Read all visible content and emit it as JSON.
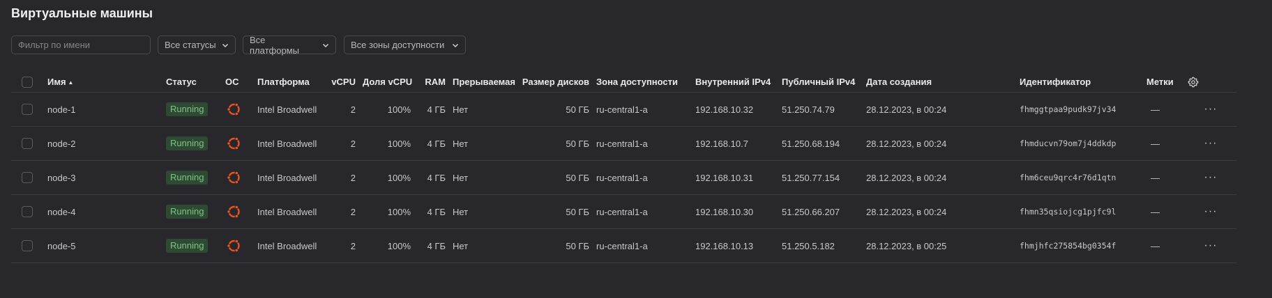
{
  "page": {
    "title": "Виртуальные машины"
  },
  "filters": {
    "name_placeholder": "Фильтр по имени",
    "status_select": "Все статусы",
    "platform_select": "Все платформы",
    "zone_select": "Все зоны доступности"
  },
  "table": {
    "columns": {
      "name": "Имя",
      "status": "Статус",
      "os": "ОС",
      "platform": "Платформа",
      "vcpu": "vCPU",
      "vcpu_share": "Доля vCPU",
      "ram": "RAM",
      "preemptible": "Прерываемая",
      "disk_size": "Размер дисков",
      "zone": "Зона доступности",
      "internal_ip": "Внутренний IPv4",
      "public_ip": "Публичный IPv4",
      "created": "Дата создания",
      "id": "Идентификатор",
      "labels": "Метки"
    },
    "sort_indicator": "▲",
    "os_icon": "ubuntu-icon",
    "status_color": "#7fc284",
    "rows": [
      {
        "name": "node-1",
        "status": "Running",
        "platform": "Intel Broadwell",
        "vcpu": "2",
        "vcpu_share": "100%",
        "ram": "4 ГБ",
        "preemptible": "Нет",
        "disk_size": "50 ГБ",
        "zone": "ru-central1-a",
        "internal_ip": "192.168.10.32",
        "public_ip": "51.250.74.79",
        "created": "28.12.2023, в 00:24",
        "id": "fhmggtpaa9pudk97jv34",
        "labels": "—",
        "actions": "···"
      },
      {
        "name": "node-2",
        "status": "Running",
        "platform": "Intel Broadwell",
        "vcpu": "2",
        "vcpu_share": "100%",
        "ram": "4 ГБ",
        "preemptible": "Нет",
        "disk_size": "50 ГБ",
        "zone": "ru-central1-a",
        "internal_ip": "192.168.10.7",
        "public_ip": "51.250.68.194",
        "created": "28.12.2023, в 00:24",
        "id": "fhmducvn79om7j4ddkdp",
        "labels": "—",
        "actions": "···"
      },
      {
        "name": "node-3",
        "status": "Running",
        "platform": "Intel Broadwell",
        "vcpu": "2",
        "vcpu_share": "100%",
        "ram": "4 ГБ",
        "preemptible": "Нет",
        "disk_size": "50 ГБ",
        "zone": "ru-central1-a",
        "internal_ip": "192.168.10.31",
        "public_ip": "51.250.77.154",
        "created": "28.12.2023, в 00:24",
        "id": "fhm6ceu9qrc4r76d1qtn",
        "labels": "—",
        "actions": "···"
      },
      {
        "name": "node-4",
        "status": "Running",
        "platform": "Intel Broadwell",
        "vcpu": "2",
        "vcpu_share": "100%",
        "ram": "4 ГБ",
        "preemptible": "Нет",
        "disk_size": "50 ГБ",
        "zone": "ru-central1-a",
        "internal_ip": "192.168.10.30",
        "public_ip": "51.250.66.207",
        "created": "28.12.2023, в 00:24",
        "id": "fhmn35qsiojcg1pjfc9l",
        "labels": "—",
        "actions": "···"
      },
      {
        "name": "node-5",
        "status": "Running",
        "platform": "Intel Broadwell",
        "vcpu": "2",
        "vcpu_share": "100%",
        "ram": "4 ГБ",
        "preemptible": "Нет",
        "disk_size": "50 ГБ",
        "zone": "ru-central1-a",
        "internal_ip": "192.168.10.13",
        "public_ip": "51.250.5.182",
        "created": "28.12.2023, в 00:25",
        "id": "fhmjhfc275854bg0354f",
        "labels": "—",
        "actions": "···"
      }
    ]
  }
}
